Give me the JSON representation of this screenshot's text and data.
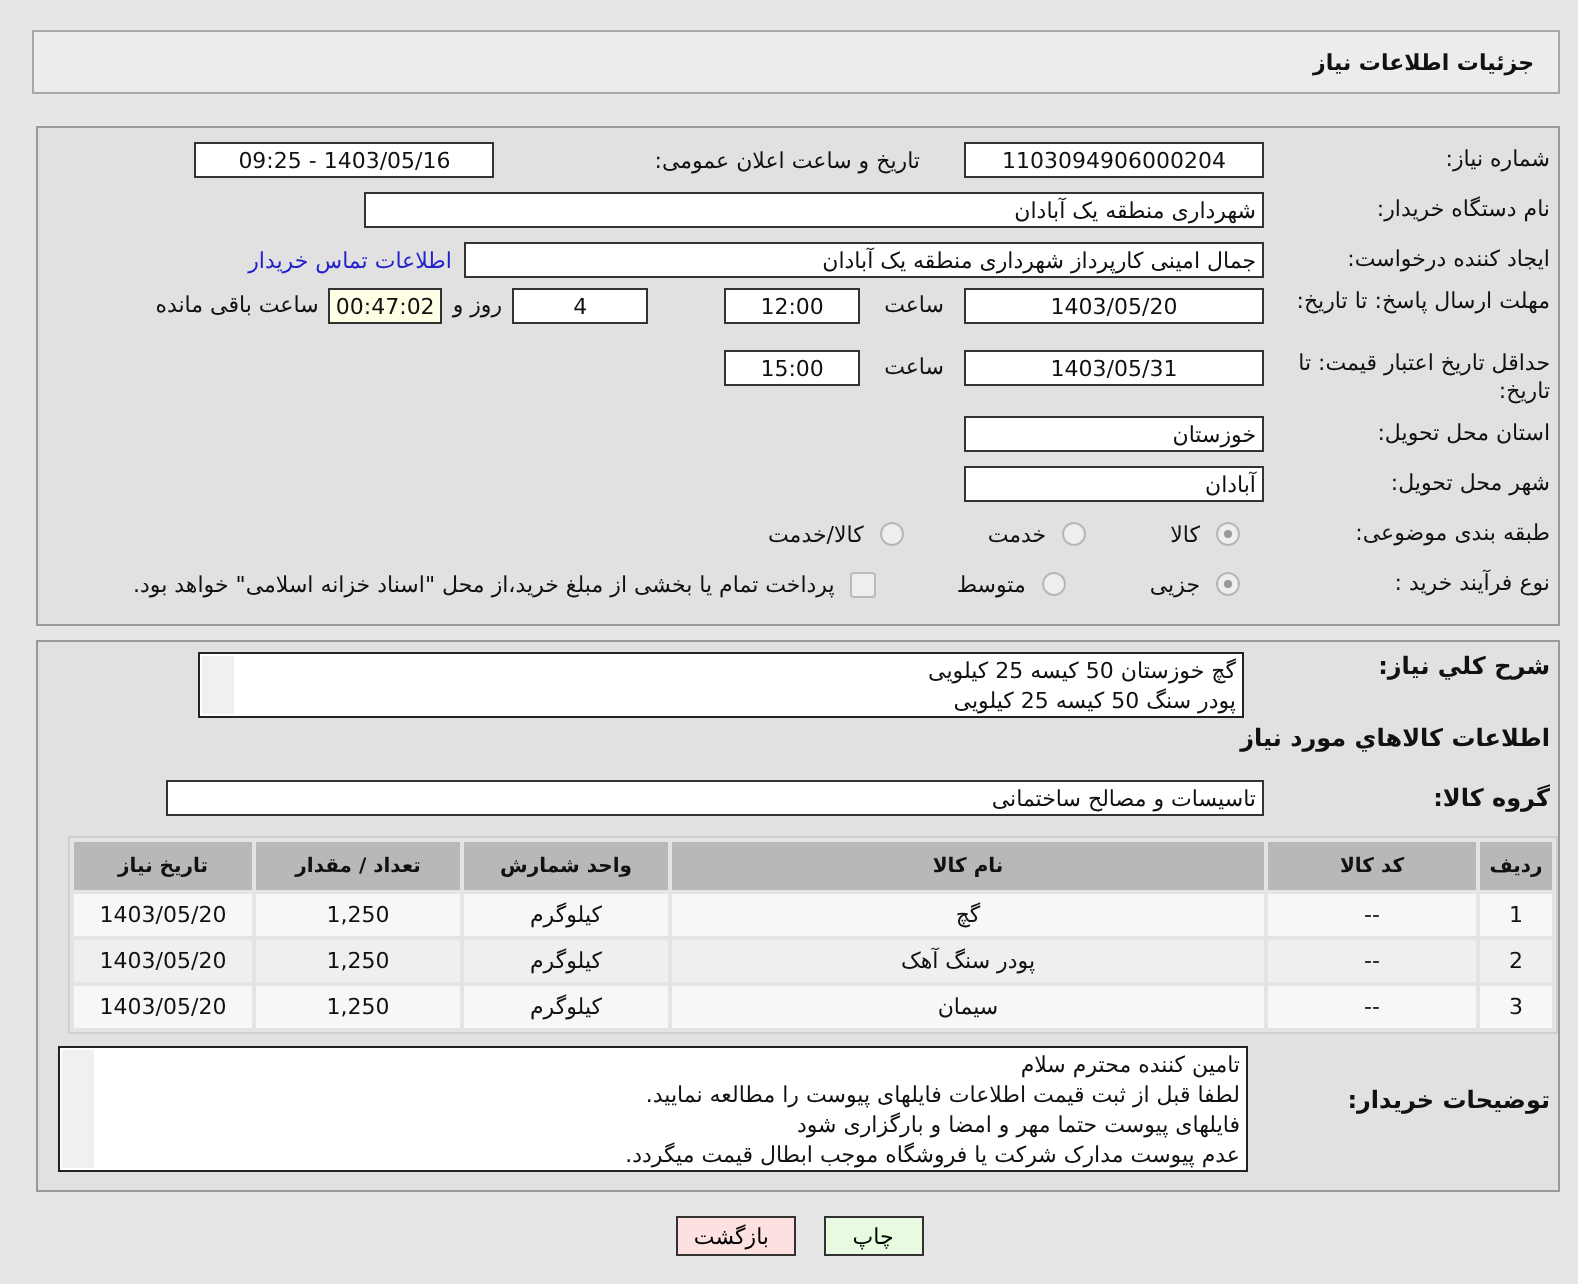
{
  "header": {
    "title": "جزئیات اطلاعات نیاز"
  },
  "need_info": {
    "need_number": {
      "label": "شماره نیاز:",
      "value": "1103094906000204"
    },
    "announce": {
      "label": "تاریخ و ساعت اعلان عمومی:",
      "value": "1403/05/16 - 09:25"
    },
    "buyer_org": {
      "label": "نام دستگاه خریدار:",
      "value": "شهرداری منطقه یک آبادان"
    },
    "requester": {
      "label": "ایجاد کننده درخواست:",
      "value": "جمال امینی کارپرداز شهرداری منطقه یک آبادان",
      "link": "اطلاعات تماس خریدار"
    },
    "response_deadline": {
      "label": "مهلت ارسال پاسخ: تا تاریخ:",
      "date": "1403/05/20",
      "time_label": "ساعت",
      "time": "12:00",
      "days": "4",
      "days_label": "روز و",
      "remaining": "00:47:02",
      "remaining_label": "ساعت باقی مانده"
    },
    "price_validity": {
      "label": "حداقل تاریخ اعتبار قیمت: تا تاریخ:",
      "date": "1403/05/31",
      "time_label": "ساعت",
      "time": "15:00"
    },
    "province": {
      "label": "استان محل تحویل:",
      "value": "خوزستان"
    },
    "city": {
      "label": "شهر محل تحویل:",
      "value": "آبادان"
    },
    "category": {
      "label": "طبقه بندی موضوعی:",
      "options": [
        {
          "label": "کالا",
          "selected": true
        },
        {
          "label": "خدمت",
          "selected": false
        },
        {
          "label": "کالا/خدمت",
          "selected": false
        }
      ]
    },
    "purchase_type": {
      "label": "نوع فرآیند خرید :",
      "options": [
        {
          "label": "جزیی",
          "selected": true
        },
        {
          "label": "متوسط",
          "selected": false
        }
      ],
      "payment_note": {
        "label": "پرداخت تمام یا بخشی از مبلغ خرید،از محل \"اسناد خزانه اسلامی\" خواهد بود.",
        "checked": false
      }
    }
  },
  "details": {
    "description": {
      "label": "شرح کلي نياز:",
      "lines": [
        "گچ خوزستان 50 کیسه 25 کیلویی",
        "پودر سنگ 50 کیسه 25 کیلویی"
      ]
    },
    "items_heading": "اطلاعات کالاهاي مورد نياز",
    "goods_group": {
      "label": "گروه کالا:",
      "value": "تاسیسات و مصالح ساختمانی"
    },
    "table": {
      "columns": [
        "ردیف",
        "کد کالا",
        "نام کالا",
        "واحد شمارش",
        "تعداد / مقدار",
        "تاریخ نیاز"
      ],
      "rows": [
        [
          "1",
          "--",
          "گچ",
          "کیلوگرم",
          "1,250",
          "1403/05/20"
        ],
        [
          "2",
          "--",
          "پودر سنگ آهک",
          "کیلوگرم",
          "1,250",
          "1403/05/20"
        ],
        [
          "3",
          "--",
          "سیمان",
          "کیلوگرم",
          "1,250",
          "1403/05/20"
        ]
      ]
    },
    "buyer_notes": {
      "label": "توضیحات خریدار:",
      "lines": [
        "تامین کننده محترم سلام",
        "لطفا قبل از ثبت قیمت اطلاعات فایلهای پیوست را مطالعه نمایید.",
        "فایلهای پیوست حتما مهر و امضا و بارگزاری شود",
        "عدم پیوست مدارک شرکت یا فروشگاه موجب ابطال قیمت میگردد."
      ]
    }
  },
  "buttons": [
    {
      "label": "چاپ",
      "kind": "print"
    },
    {
      "label": "بازگشت",
      "kind": "back"
    }
  ]
}
